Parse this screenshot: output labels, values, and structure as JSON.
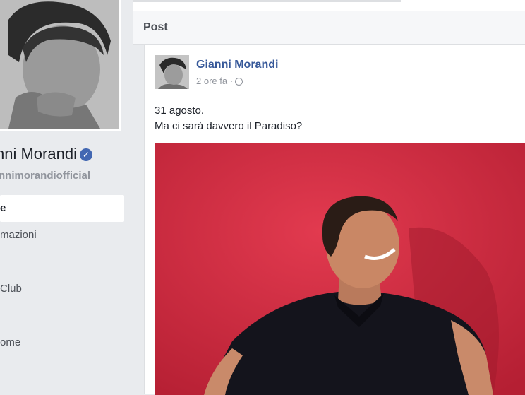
{
  "sidebar": {
    "page_name": "nni Morandi",
    "handle": "nnimorandiofficial",
    "nav_items": [
      {
        "label": "e",
        "active": true
      },
      {
        "label": "mazioni",
        "active": false
      },
      {
        "label": "",
        "active": false
      },
      {
        "label": "Club",
        "active": false
      },
      {
        "label": "",
        "active": false
      },
      {
        "label": "ome",
        "active": false
      },
      {
        "label": "",
        "active": false
      }
    ]
  },
  "main": {
    "section_title": "Post",
    "post": {
      "author": "Gianni Morandi",
      "time": "2 ore fa ·",
      "text_line1": "31 agosto.",
      "text_line2": "Ma ci sarà davvero il Paradiso?"
    }
  },
  "icons": {
    "verified": "verified-badge-icon",
    "audience": "globe-icon"
  },
  "colors": {
    "link": "#365899",
    "background": "#e9ebee",
    "photo_background": "#d42a3e"
  }
}
